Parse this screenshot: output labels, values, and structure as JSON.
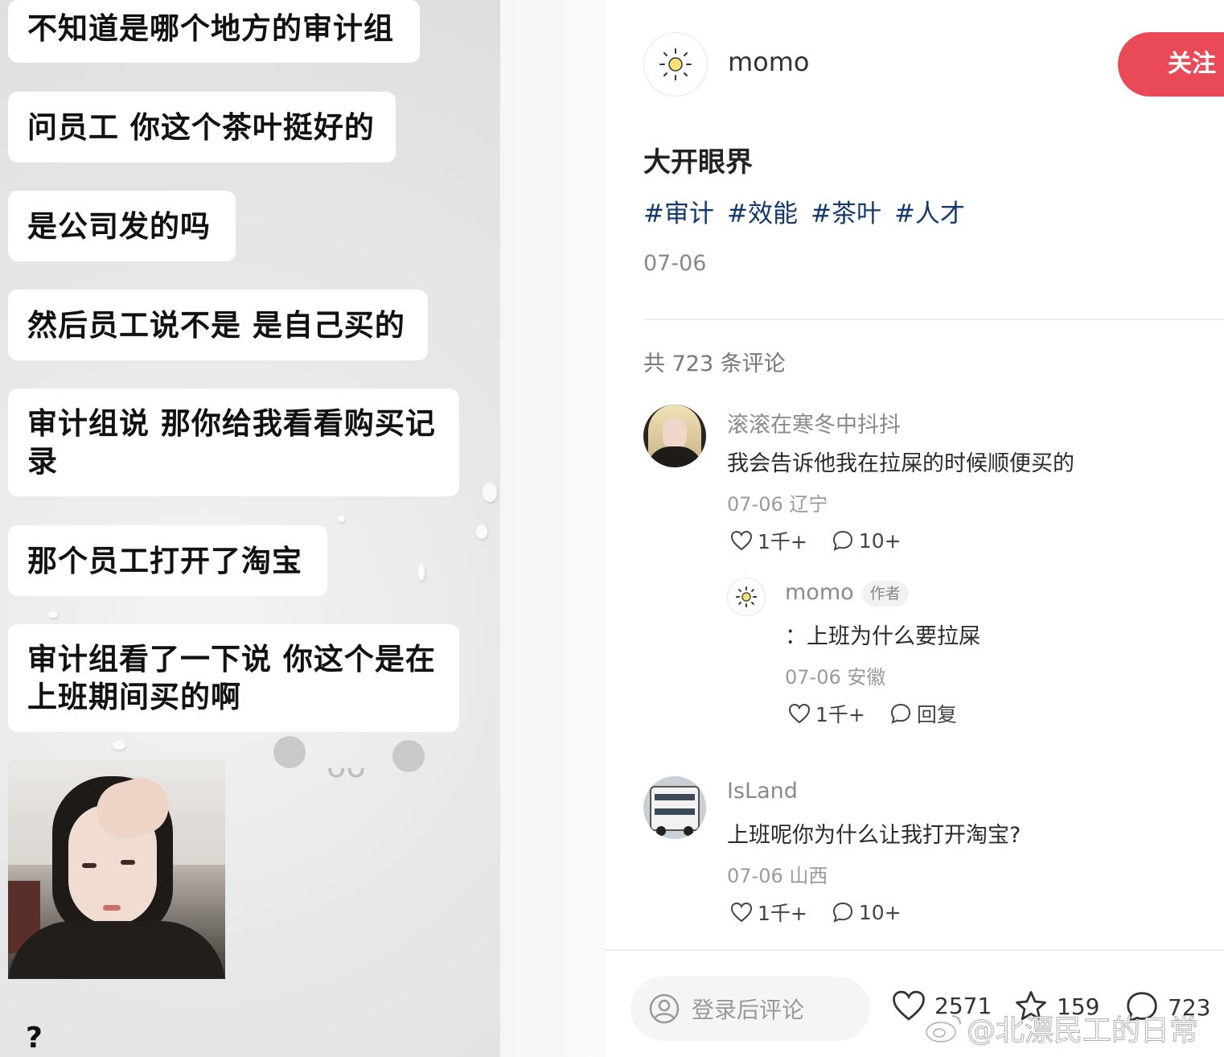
{
  "chat": {
    "messages": [
      "不知道是哪个地方的审计组",
      "问员工 你这个茶叶挺好的",
      "是公司发的吗",
      "然后员工说不是 是自己买的",
      "审计组说 那你给我看看购买记录",
      "那个员工打开了淘宝",
      "审计组看了一下说 你这个是在上班期间买的啊"
    ],
    "last_message": "?"
  },
  "post": {
    "author": "momo",
    "follow_label": "关注",
    "title": "大开眼界",
    "tags": [
      "#审计",
      "#效能",
      "#茶叶",
      "#人才"
    ],
    "date": "07-06",
    "comment_count_label": "共 723 条评论"
  },
  "comments": [
    {
      "user": "滚滚在寒冬中抖抖",
      "text": "我会告诉他我在拉屎的时候顺便买的",
      "meta": "07-06 辽宁",
      "likes": "1千+",
      "replies": "10+",
      "reply": {
        "user": "momo",
        "badge": "作者",
        "text": "：上班为什么要拉屎",
        "meta": "07-06 安徽",
        "likes": "1千+",
        "reply_label": "回复"
      }
    },
    {
      "user": "IsLand",
      "text": "上班呢你为什么让我打开淘宝?",
      "meta": "07-06 山西",
      "likes": "1千+",
      "replies": "10+"
    }
  ],
  "bottom_bar": {
    "input_placeholder": "登录后评论",
    "likes": "2571",
    "favorites": "159",
    "comments": "723"
  },
  "watermark": "@北漂民工的日常",
  "colors": {
    "follow_button": "#ea4a57",
    "tag_text": "#13386c"
  }
}
